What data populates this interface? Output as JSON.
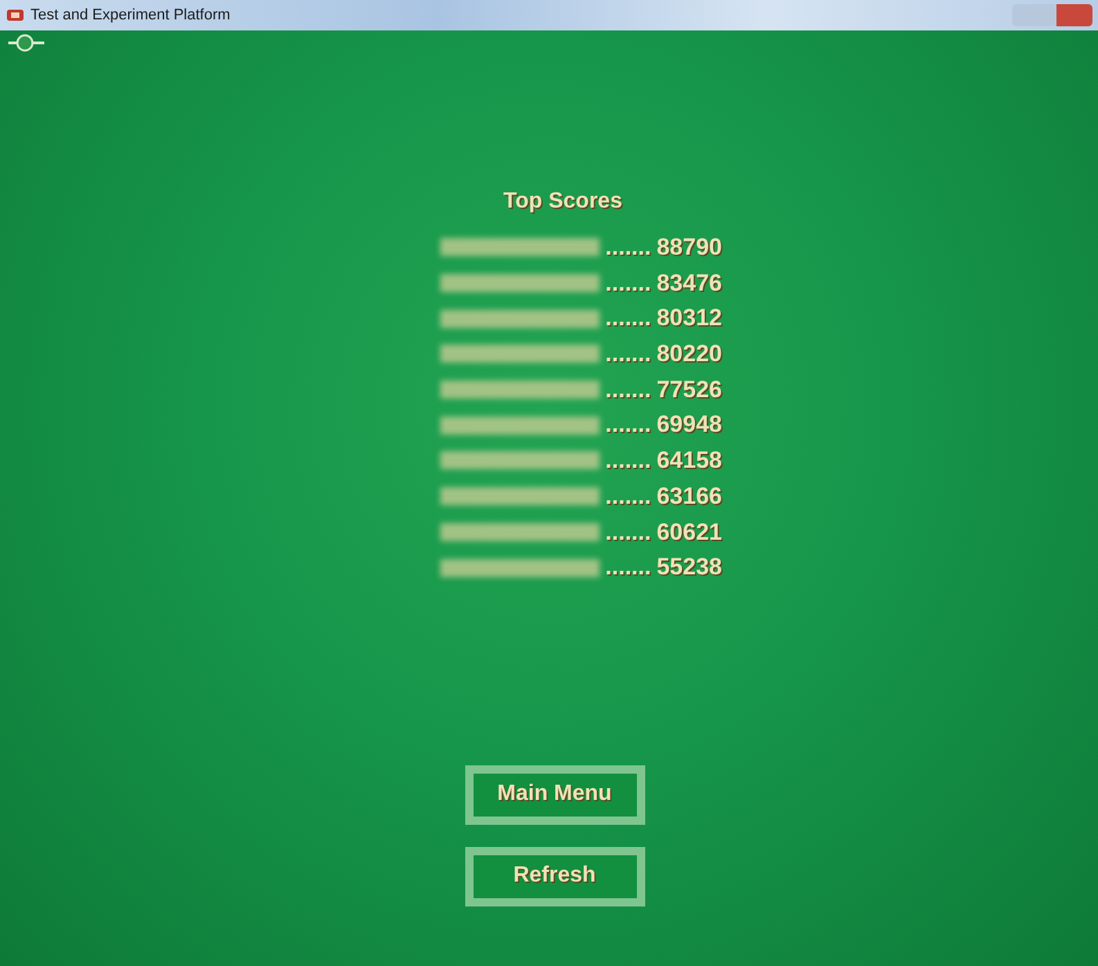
{
  "window": {
    "title": "Test and Experiment Platform"
  },
  "heading": "Top Scores",
  "scores": [
    {
      "dots": ".......",
      "score": "88790"
    },
    {
      "dots": ".......",
      "score": "83476"
    },
    {
      "dots": ".......",
      "score": "80312"
    },
    {
      "dots": ".......",
      "score": "80220"
    },
    {
      "dots": ".......",
      "score": "77526"
    },
    {
      "dots": ".......",
      "score": "69948"
    },
    {
      "dots": ".......",
      "score": "64158"
    },
    {
      "dots": ".......",
      "score": "63166"
    },
    {
      "dots": ".......",
      "score": "60621"
    },
    {
      "dots": ".......",
      "score": "55238"
    }
  ],
  "buttons": [
    "Main Menu",
    "Refresh"
  ]
}
